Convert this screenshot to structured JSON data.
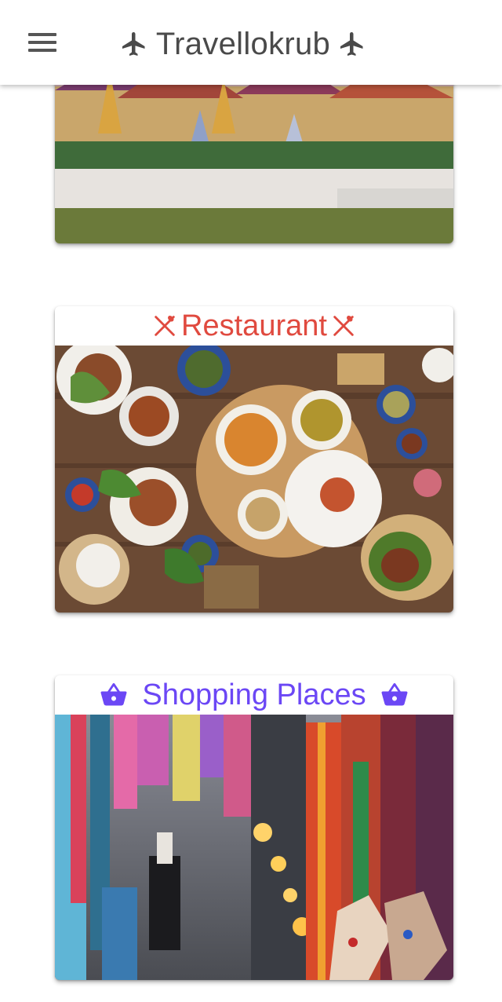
{
  "app": {
    "title": "Travellokrub",
    "title_color": "#4a4a4a",
    "icons": [
      "menu-icon",
      "airplane-icon"
    ]
  },
  "cards": [
    {
      "label": "",
      "image": "grand-palace-photo"
    },
    {
      "label": "Restaurant",
      "color": "#e04a3f",
      "icon": "cutlery-icon",
      "image": "thai-food-spread-photo"
    },
    {
      "label": "Shopping Places",
      "color": "#6b47f5",
      "icon": "shopping-basket-icon",
      "image": "market-stalls-photo"
    }
  ]
}
